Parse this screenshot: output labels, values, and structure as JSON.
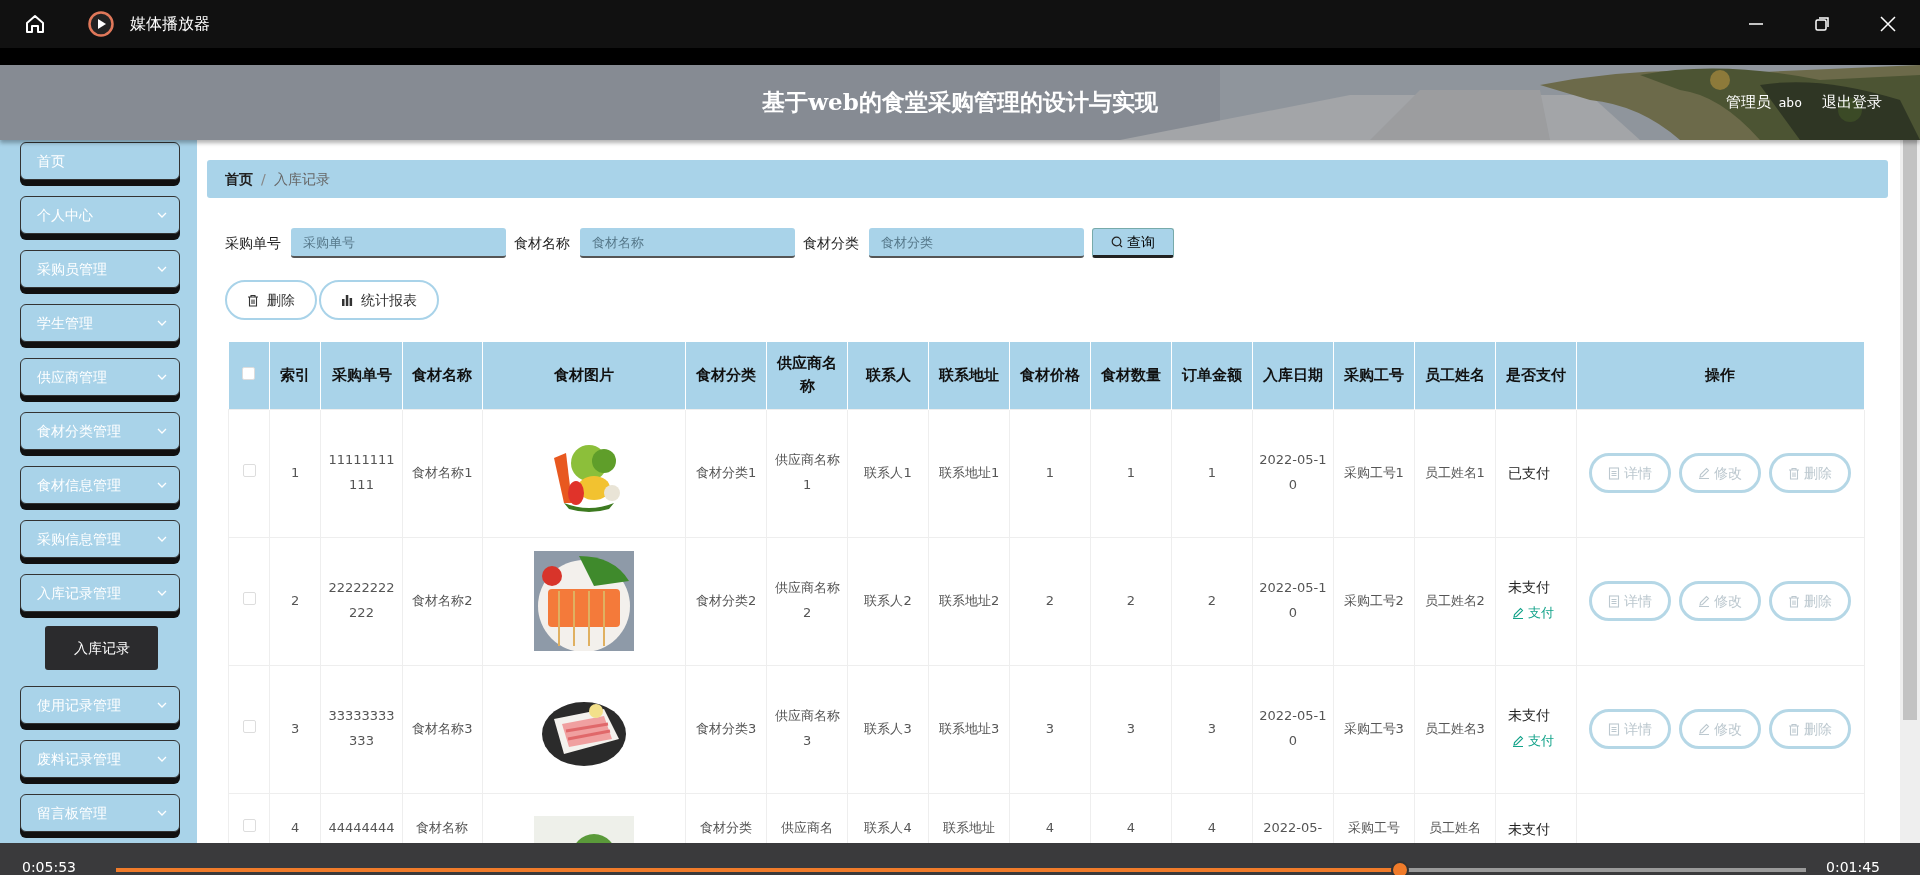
{
  "player": {
    "title": "媒体播放器",
    "elapsed": "0:05:53",
    "remaining": "0:01:45",
    "level": 0.76
  },
  "header": {
    "title": "基于web的食堂采购管理的设计与实现",
    "user_role": "管理员",
    "user_name": "abo",
    "logout": "退出登录"
  },
  "sidebar": {
    "items": [
      {
        "label": "首页",
        "kind": "link"
      },
      {
        "label": "个人中心",
        "kind": "menu"
      },
      {
        "label": "采购员管理",
        "kind": "menu"
      },
      {
        "label": "学生管理",
        "kind": "menu"
      },
      {
        "label": "供应商管理",
        "kind": "menu"
      },
      {
        "label": "食材分类管理",
        "kind": "menu"
      },
      {
        "label": "食材信息管理",
        "kind": "menu"
      },
      {
        "label": "采购信息管理",
        "kind": "menu"
      },
      {
        "label": "入库记录管理",
        "kind": "menu",
        "children": [
          {
            "label": "入库记录",
            "selected": true
          }
        ]
      },
      {
        "label": "使用记录管理",
        "kind": "menu"
      },
      {
        "label": "废料记录管理",
        "kind": "menu"
      },
      {
        "label": "留言板管理",
        "kind": "menu"
      }
    ]
  },
  "breadcrumb": [
    {
      "label": "首页",
      "active": false
    },
    {
      "label": "入库记录",
      "active": true
    }
  ],
  "breadcrumb_separator": "/",
  "search": {
    "fields": [
      {
        "label": "采购单号",
        "placeholder": "采购单号"
      },
      {
        "label": "食材名称",
        "placeholder": "食材名称"
      },
      {
        "label": "食材分类",
        "placeholder": "食材分类"
      }
    ],
    "button": "查询"
  },
  "actions": [
    {
      "label": "删除",
      "kind": "trash"
    },
    {
      "label": "统计报表",
      "kind": "chart"
    }
  ],
  "table": {
    "select_all": false,
    "columns": [
      "索引",
      "采购单号",
      "食材名称",
      "食材图片",
      "食材分类",
      "供应商名称",
      "联系人",
      "联系地址",
      "食材价格",
      "食材数量",
      "订单金额",
      "入库日期",
      "采购工号",
      "员工姓名",
      "是否支付",
      "操作"
    ],
    "rows": [
      {
        "checked": false,
        "cells": [
          "1",
          "11111111111",
          "食材名称1",
          null,
          "食材分类1",
          "供应商名称1",
          "联系人1",
          "联系地址1",
          "1",
          "1",
          "1",
          "2022-05-10",
          "采购工号1",
          "员工姓名1"
        ],
        "pay_status": "已支付",
        "actions": [
          "详情",
          "修改",
          "删除"
        ]
      },
      {
        "checked": false,
        "cells": [
          "2",
          "22222222222",
          "食材名称2",
          null,
          "食材分类2",
          "供应商名称2",
          "联系人2",
          "联系地址2",
          "2",
          "2",
          "2",
          "2022-05-10",
          "采购工号2",
          "员工姓名2"
        ],
        "pay_status": "未支付",
        "pay_link": "支付",
        "actions": [
          "详情",
          "修改",
          "删除"
        ]
      },
      {
        "checked": false,
        "cells": [
          "3",
          "33333333333",
          "食材名称3",
          null,
          "食材分类3",
          "供应商名称3",
          "联系人3",
          "联系地址3",
          "3",
          "3",
          "3",
          "2022-05-10",
          "采购工号3",
          "员工姓名3"
        ],
        "pay_status": "未支付",
        "pay_link": "支付",
        "actions": [
          "详情",
          "修改",
          "删除"
        ]
      },
      {
        "checked": false,
        "cells": [
          "4",
          "44444444",
          "食材名称",
          null,
          "食材分类",
          "供应商名",
          "联系人4",
          "联系地址",
          "4",
          "4",
          "4",
          "2022-05-",
          "采购工号",
          "员工姓名"
        ],
        "pay_status": "未支付"
      }
    ]
  }
}
